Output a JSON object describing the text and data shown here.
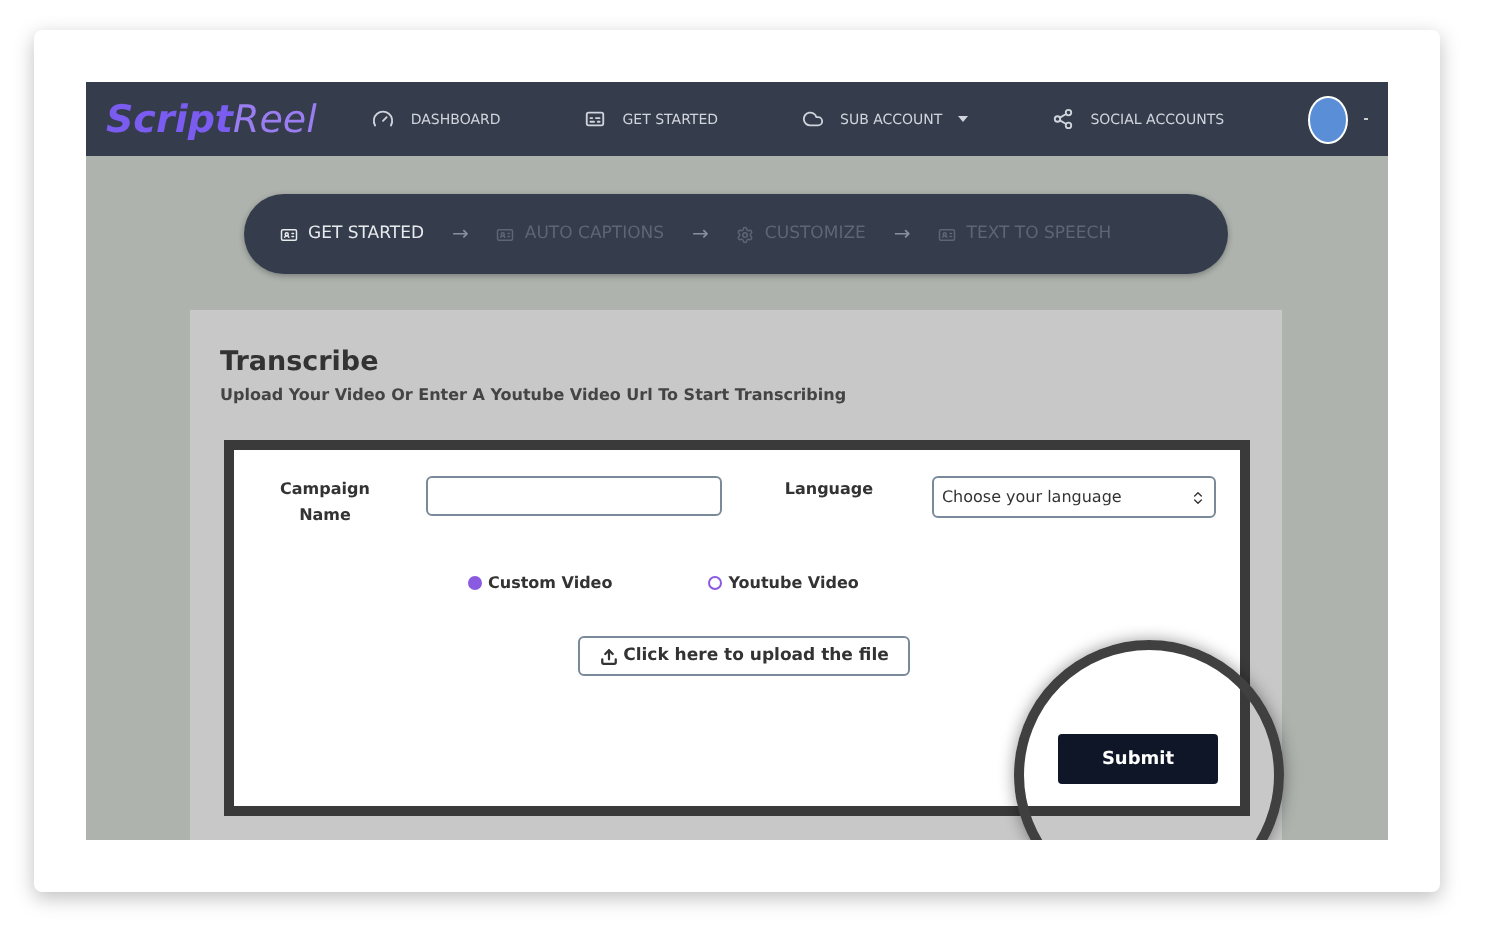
{
  "navbar": {
    "logo": "**Script**Reel",
    "items": [
      {
        "label": "DASHBOARD",
        "dropdown": false
      },
      {
        "label": "GET STARTED",
        "dropdown": false
      },
      {
        "label": "SUB ACCOUNT",
        "dropdown": true
      },
      {
        "label": "SOCIAL ACCOUNTS",
        "dropdown": false
      }
    ]
  },
  "steps": [
    {
      "label": "GET STARTED",
      "selected": true
    },
    {
      "label": "AUTO CAPTIONS",
      "selected": false
    },
    {
      "label": "CUSTOMIZE",
      "selected": false
    },
    {
      "label": "TEXT TO SPEECH",
      "selected": false
    }
  ],
  "step_separator": "→",
  "card": {
    "title": "Transcribe",
    "subtitle": "Upload Your Video Or Enter A Youtube Video Url To Start Transcribing"
  },
  "form": {
    "campaign_label": "Campaign Name",
    "language_label": "Language",
    "language_placeholder": "Choose your language",
    "sources": [
      {
        "label": "Custom Video",
        "selected": true
      },
      {
        "label": "Youtube Video",
        "selected": false
      }
    ],
    "upload_button": "Click here to upload the file",
    "submit_button": "Submit"
  }
}
